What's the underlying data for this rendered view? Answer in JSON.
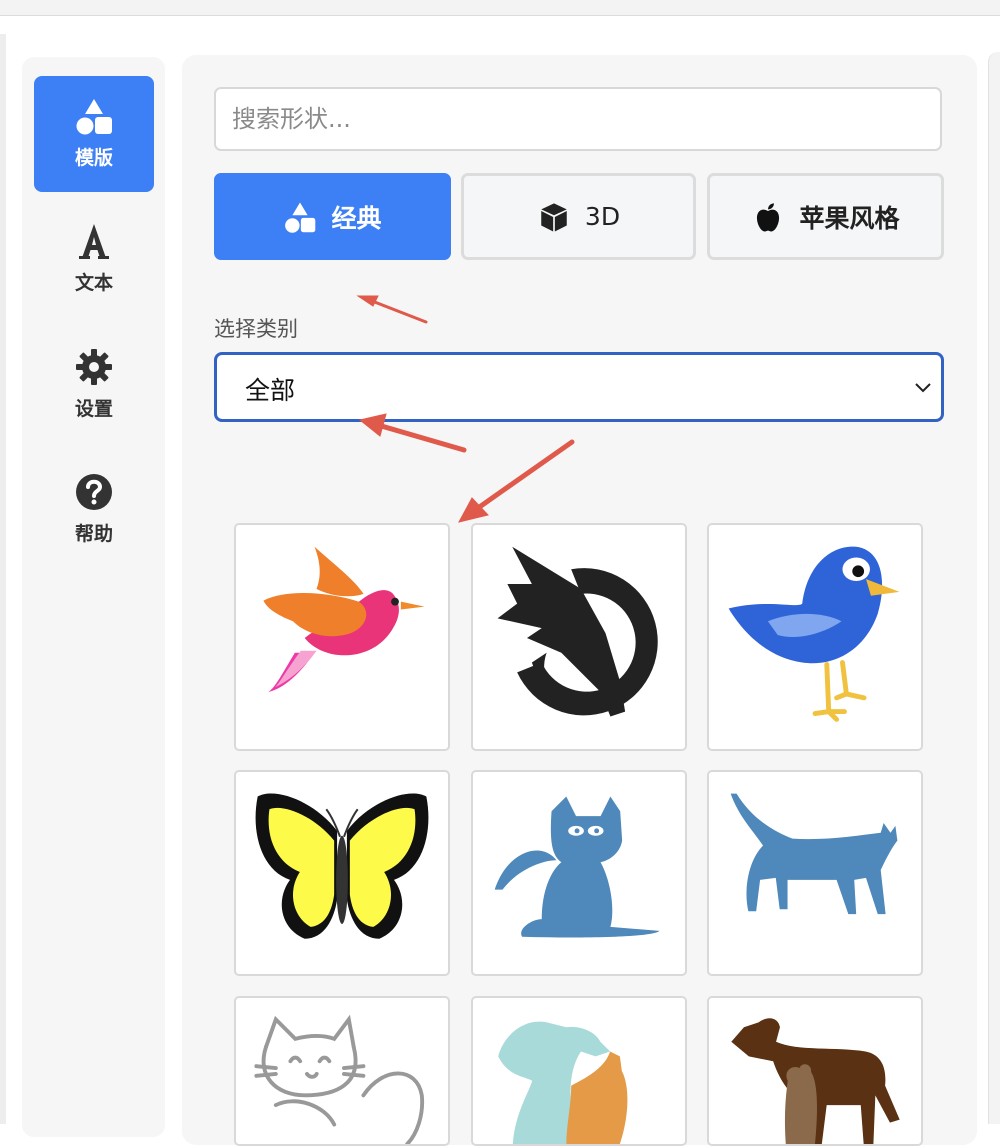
{
  "sidebar": {
    "items": [
      {
        "label": "模版",
        "icon": "shapes-icon",
        "active": true
      },
      {
        "label": "文本",
        "icon": "text-a-icon",
        "active": false
      },
      {
        "label": "设置",
        "icon": "gear-icon",
        "active": false
      },
      {
        "label": "帮助",
        "icon": "question-circle-icon",
        "active": false
      }
    ]
  },
  "search": {
    "placeholder": "搜索形状...",
    "value": ""
  },
  "styles": [
    {
      "label": "经典",
      "icon": "shapes-icon",
      "active": true
    },
    {
      "label": "3D",
      "icon": "cube-icon",
      "active": false
    },
    {
      "label": "苹果风格",
      "icon": "apple-icon",
      "active": false
    }
  ],
  "category": {
    "label": "选择类别",
    "selected": "全部"
  },
  "shapes": [
    {
      "icon": "pink-bird-icon"
    },
    {
      "icon": "eagle-emblem-icon"
    },
    {
      "icon": "blue-bird-icon"
    },
    {
      "icon": "butterfly-icon"
    },
    {
      "icon": "sitting-cat-icon"
    },
    {
      "icon": "walking-cat-icon"
    },
    {
      "icon": "cat-sketch-icon"
    },
    {
      "icon": "dog-and-cat-icon"
    },
    {
      "icon": "dog-icon"
    }
  ],
  "colors": {
    "accent": "#3d7ff5",
    "select_border": "#3262c4",
    "annotation_arrow": "#e05a4b"
  }
}
